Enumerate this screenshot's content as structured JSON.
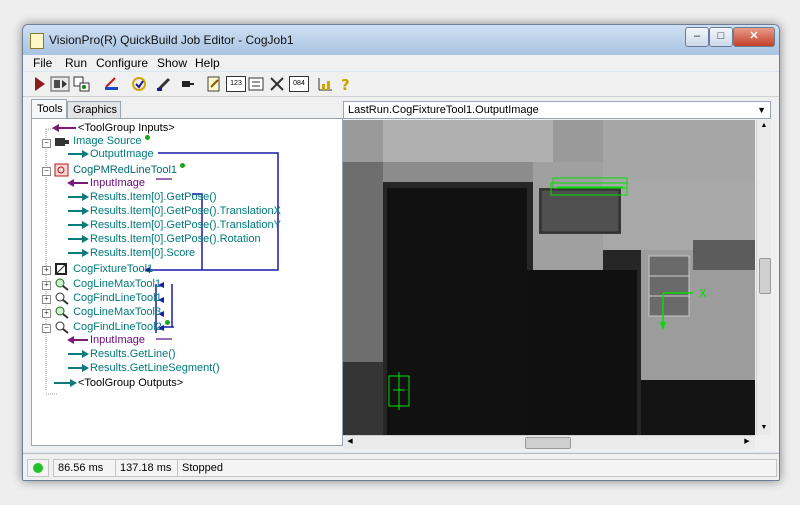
{
  "window": {
    "title": "VisionPro(R) QuickBuild Job Editor - CogJob1",
    "minimize_glyph": "–",
    "maximize_glyph": "□",
    "close_glyph": "✕"
  },
  "menu": [
    "File",
    "Run",
    "Configure",
    "Show",
    "Help"
  ],
  "toolbar": {
    "icons": [
      "run-once-icon",
      "run-continuous-icon",
      "tool-display-icon",
      "reset-icon",
      "edit-script-icon",
      "edit-icon",
      "comment-icon",
      "edit-text-icon",
      "number-123-icon",
      "checklist-icon",
      "tools-icon",
      "numeric-084-icon",
      "statistics-icon",
      "help-icon"
    ],
    "badge_123": "123",
    "badge_084": "084"
  },
  "tabs": {
    "tools": "Tools",
    "graphics": "Graphics"
  },
  "tree": {
    "inputs": "<ToolGroup Inputs>",
    "image_source": "Image Source",
    "output_image": "OutputImage",
    "pm_tool": "CogPMRedLineTool1",
    "input_image": "InputImage",
    "get_pose": "Results.Item[0].GetPose()",
    "translation_x": "Results.Item[0].GetPose().TranslationX",
    "translation_y": "Results.Item[0].GetPose().TranslationY",
    "rotation": "Results.Item[0].GetPose().Rotation",
    "score": "Results.Item[0].Score",
    "fixture_tool": "CogFixtureTool1",
    "line_max_1": "CogLineMaxTool1",
    "find_line_1": "CogFindLineTool1",
    "line_max_3": "CogLineMaxTool3",
    "find_line_2": "CogFindLineTool2",
    "input_image_2": "InputImage",
    "get_line": "Results.GetLine()",
    "get_line_segment": "Results.GetLineSegment()",
    "outputs": "<ToolGroup Outputs>"
  },
  "image_view": {
    "selected_image": "LastRun.CogFixtureTool1.OutputImage",
    "x_label": "X"
  },
  "status": {
    "indicator_color": "#22c02a",
    "time_1": "86.56 ms",
    "time_2": "137.18 ms",
    "state": "Stopped"
  },
  "colors": {
    "link_blue": "#1a1aa8",
    "input_purple": "#7a1a7a",
    "teal_text": "#007a7a",
    "overlay_green": "#00e000"
  }
}
